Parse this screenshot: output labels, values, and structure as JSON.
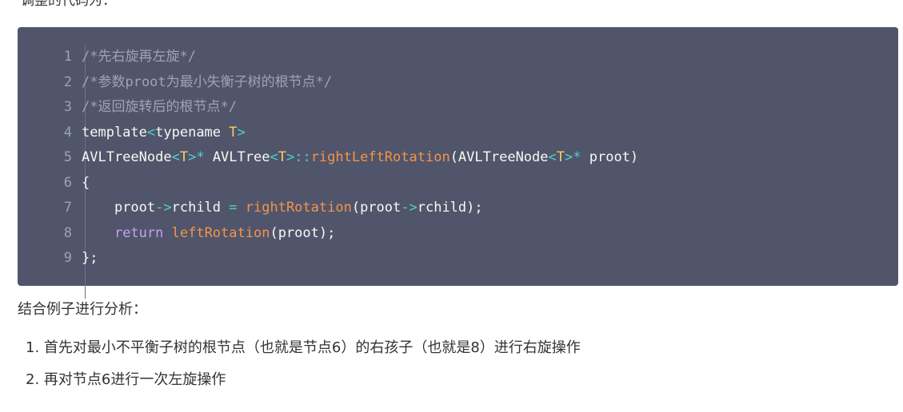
{
  "top_text": "调整的代码为：",
  "code": {
    "line_numbers": [
      "1",
      "2",
      "3",
      "4",
      "5",
      "6",
      "7",
      "8",
      "9"
    ],
    "lines": [
      [
        {
          "cls": "c",
          "text": "/*先右旋再左旋*/"
        }
      ],
      [
        {
          "cls": "c",
          "text": "/*参数proot为最小失衡子树的根节点*/"
        }
      ],
      [
        {
          "cls": "c",
          "text": "/*返回旋转后的根节点*/"
        }
      ],
      [
        {
          "cls": "n",
          "text": "template"
        },
        {
          "cls": "o",
          "text": "<"
        },
        {
          "cls": "n",
          "text": "typename "
        },
        {
          "cls": "t",
          "text": "T"
        },
        {
          "cls": "o",
          "text": ">"
        }
      ],
      [
        {
          "cls": "n",
          "text": "AVLTreeNode"
        },
        {
          "cls": "o",
          "text": "<"
        },
        {
          "cls": "t",
          "text": "T"
        },
        {
          "cls": "o",
          "text": ">*"
        },
        {
          "cls": "n",
          "text": " AVLTree"
        },
        {
          "cls": "o",
          "text": "<"
        },
        {
          "cls": "t",
          "text": "T"
        },
        {
          "cls": "o",
          "text": ">::"
        },
        {
          "cls": "f",
          "text": "rightLeftRotation"
        },
        {
          "cls": "n",
          "text": "(AVLTreeNode"
        },
        {
          "cls": "o",
          "text": "<"
        },
        {
          "cls": "t",
          "text": "T"
        },
        {
          "cls": "o",
          "text": ">*"
        },
        {
          "cls": "n",
          "text": " proot)"
        }
      ],
      [
        {
          "cls": "n",
          "text": "{"
        }
      ],
      [
        {
          "cls": "n",
          "text": "    proot"
        },
        {
          "cls": "o",
          "text": "->"
        },
        {
          "cls": "n",
          "text": "rchild "
        },
        {
          "cls": "o",
          "text": "="
        },
        {
          "cls": "n",
          "text": " "
        },
        {
          "cls": "f",
          "text": "rightRotation"
        },
        {
          "cls": "n",
          "text": "(proot"
        },
        {
          "cls": "o",
          "text": "->"
        },
        {
          "cls": "n",
          "text": "rchild);"
        }
      ],
      [
        {
          "cls": "n",
          "text": "    "
        },
        {
          "cls": "k",
          "text": "return"
        },
        {
          "cls": "n",
          "text": " "
        },
        {
          "cls": "f",
          "text": "leftRotation"
        },
        {
          "cls": "n",
          "text": "(proot);"
        }
      ],
      [
        {
          "cls": "n",
          "text": "};"
        }
      ]
    ]
  },
  "paragraph": "结合例子进行分析：",
  "list_items": [
    "1. 首先对最小不平衡子树的根节点（也就是节点6）的右孩子（也就是8）进行右旋操作",
    "2. 再对节点6进行一次左旋操作"
  ]
}
